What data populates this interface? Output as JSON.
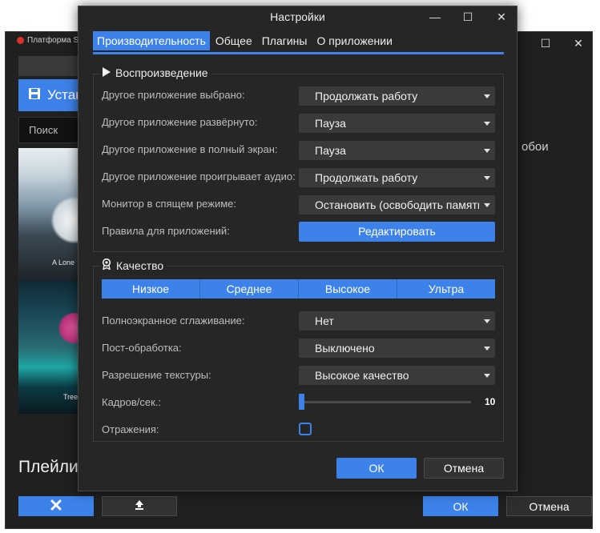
{
  "background_window": {
    "title": "Платформа Sl",
    "install_label": "Устан",
    "search_placeholder": "Поиск",
    "thumb1_label": "A Lone",
    "thumb2_label": "Tree",
    "side_text": "обои",
    "playlist_label": "Плейли",
    "ok_label": "ОК",
    "cancel_label": "Отмена"
  },
  "dialog": {
    "title": "Настройки",
    "tabs": [
      {
        "label": "Производительность",
        "active": true
      },
      {
        "label": "Общее",
        "active": false
      },
      {
        "label": "Плагины",
        "active": false
      },
      {
        "label": "О приложении",
        "active": false
      }
    ],
    "playback": {
      "header": "Воспроизведение",
      "rows": [
        {
          "label": "Другое приложение выбрано:",
          "value": "Продолжать работу"
        },
        {
          "label": "Другое приложение развёрнуто:",
          "value": "Пауза"
        },
        {
          "label": "Другое приложение в полный экран:",
          "value": "Пауза"
        },
        {
          "label": "Другое приложение проигрывает аудио:",
          "value": "Продолжать работу"
        },
        {
          "label": "Монитор в спящем режиме:",
          "value": "Остановить (освободить память)"
        }
      ],
      "rules_label": "Правила для приложений:",
      "rules_button": "Редактировать"
    },
    "quality": {
      "header": "Качество",
      "presets": [
        "Низкое",
        "Среднее",
        "Высокое",
        "Ультра"
      ],
      "rows": [
        {
          "label": "Полноэкранное сглаживание:",
          "value": "Нет"
        },
        {
          "label": "Пост-обработка:",
          "value": "Выключено"
        },
        {
          "label": "Разрешение текстуры:",
          "value": "Высокое качество"
        }
      ],
      "fps_label": "Кадров/сек.:",
      "fps_value": "10",
      "fps_fraction": 0.0,
      "reflections_label": "Отражения:",
      "reflections_checked": false
    },
    "ok_label": "ОК",
    "cancel_label": "Отмена"
  },
  "colors": {
    "accent": "#3d82e8",
    "dialog_bg": "#262626",
    "control_bg": "#3a3a3a"
  }
}
